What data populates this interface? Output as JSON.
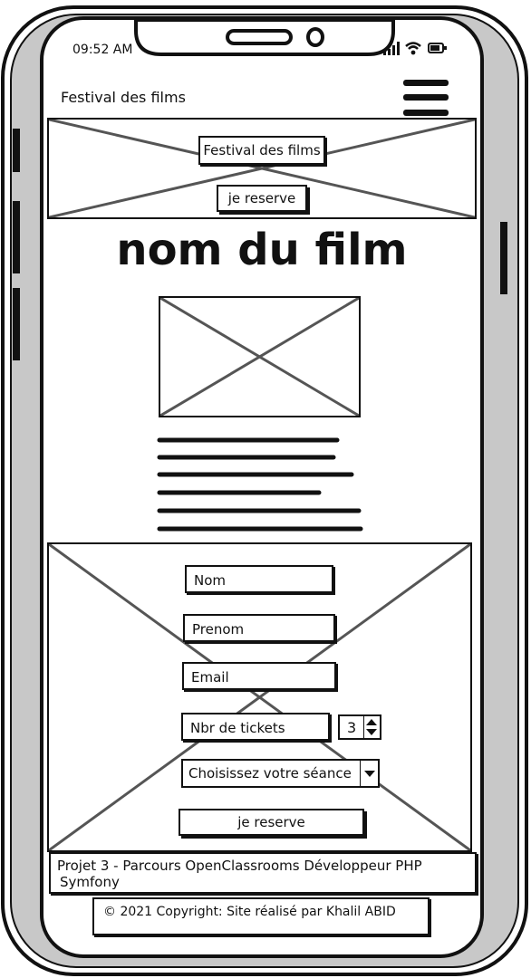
{
  "status_bar": {
    "time": "09:52 AM"
  },
  "app_bar": {
    "title": "Festival des films",
    "menu_icon": "hamburger-menu-icon"
  },
  "hero": {
    "title_button": "Festival des films",
    "reserve_button": "je reserve"
  },
  "movie": {
    "title": "nom du film",
    "image": "image-placeholder"
  },
  "form": {
    "nom_placeholder": "Nom",
    "prenom_placeholder": "Prenom",
    "email_placeholder": "Email",
    "tickets_placeholder": "Nbr de tickets",
    "tickets_value": "3",
    "seance_selected": "Choisissez votre séance",
    "submit_label": "je reserve"
  },
  "footer": {
    "project_line1": "Projet 3 - Parcours OpenClassrooms Développeur PHP",
    "project_line2": "Symfony",
    "copyright": "© 2021 Copyright: Site réalisé par Khalil ABID"
  },
  "icons": {
    "signal": "cellular-signal-icon",
    "wifi": "wifi-icon",
    "battery": "battery-icon"
  }
}
